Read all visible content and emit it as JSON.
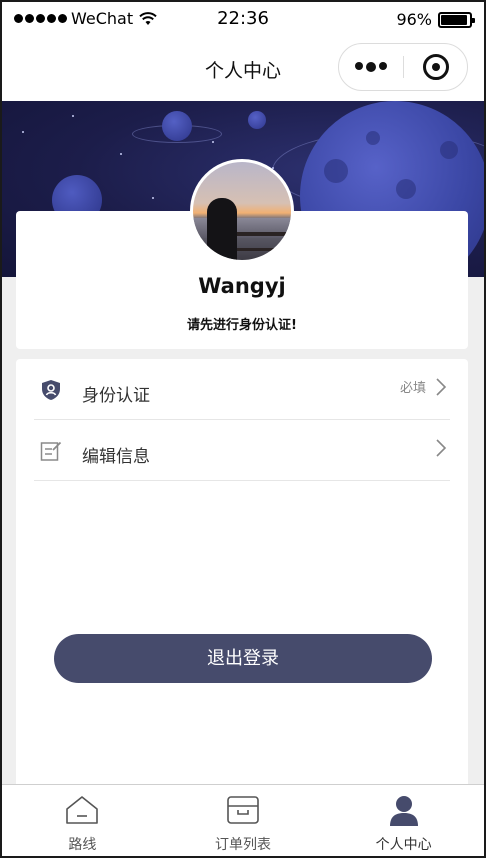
{
  "status_bar": {
    "carrier": "WeChat",
    "time": "22:36",
    "battery": "96%"
  },
  "nav": {
    "title": "个人中心"
  },
  "profile": {
    "username": "Wangyj",
    "auth_tip": "请先进行身份认证!"
  },
  "menu": {
    "items": [
      {
        "label": "身份认证",
        "hint": "必填",
        "icon": "shield-user-icon"
      },
      {
        "label": "编辑信息",
        "hint": "",
        "icon": "edit-note-icon"
      }
    ]
  },
  "logout": {
    "label": "退出登录"
  },
  "tabs": [
    {
      "label": "路线",
      "icon": "home-icon"
    },
    {
      "label": "订单列表",
      "icon": "box-icon"
    },
    {
      "label": "个人中心",
      "icon": "person-icon",
      "active": true
    }
  ],
  "colors": {
    "accent": "#464b6c",
    "banner": "#1c1d4a"
  }
}
